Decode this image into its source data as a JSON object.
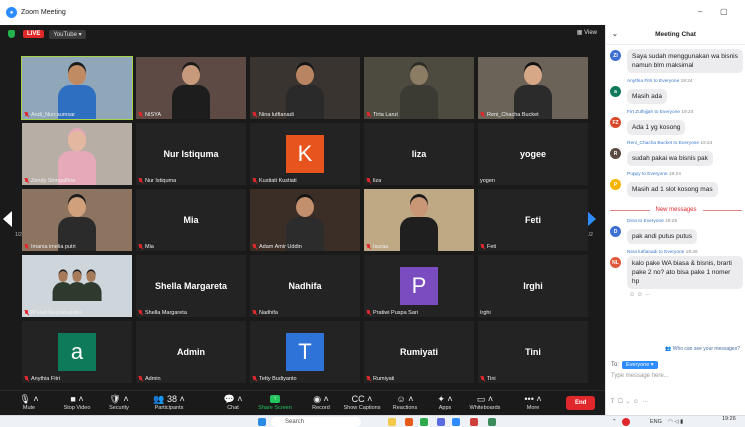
{
  "window": {
    "title": "Zoom Meeting",
    "minimize": "–",
    "restore": "▢"
  },
  "topbar": {
    "live": "LIVE",
    "stream": "YouTube ▾",
    "view": "View"
  },
  "gallery": {
    "page_left": "1/2",
    "page_right": "1/2",
    "tiles": [
      {
        "name": "Andi_Nurcaumsar",
        "video": true,
        "speaking": true,
        "bg": "#8fa7b8",
        "skin": "#c08a62",
        "shirt": "#2f6fc2",
        "hair": "#1b1b1b"
      },
      {
        "name": "NISYA",
        "video": true,
        "bg": "#5d4a44",
        "skin": "#c79a7c",
        "shirt": "#1d1d1d",
        "hair": "#1a1a1a"
      },
      {
        "name": "Nina lutfianadi",
        "video": true,
        "bg": "#3a3430",
        "skin": "#b98462",
        "shirt": "#2a2a2a",
        "hair": "#151515"
      },
      {
        "name": "Tirta Larut",
        "video": true,
        "bg": "#4d4a3f",
        "skin": "#8a7d63",
        "shirt": "#3b3a33",
        "hair": "#2e2c26"
      },
      {
        "name": "Reni_Chacha Bucket",
        "video": true,
        "bg": "#6b6357",
        "skin": "#d6a888",
        "shirt": "#2b2b2b",
        "hair": "#111111"
      },
      {
        "name": "Zendy Sinngalfina",
        "video": true,
        "bg": "#b7aea6",
        "skin": "#e4b8a0",
        "shirt": "#e6a9b9",
        "hair": "#e6a9b9"
      },
      {
        "name": "Nur Istiquma",
        "bigname": "Nur Istiquma"
      },
      {
        "name": "Kustiati Kustiati",
        "avatar": "K",
        "avatar_color": "#e8541d"
      },
      {
        "name": "liza",
        "bigname": "liza"
      },
      {
        "name": "yogen",
        "bigname": "yogee",
        "no_icon": true
      },
      {
        "name": "Imania imelia putri",
        "video": true,
        "bg": "#8c7460",
        "skin": "#d0a07c",
        "shirt": "#2b2b2b",
        "hair": "#1c1c1c"
      },
      {
        "name": "Mia",
        "bigname": "Mia"
      },
      {
        "name": "Adam Amir Uddin",
        "video": true,
        "bg": "#3a2e27",
        "skin": "#c28f6d",
        "shirt": "#2c2c2c",
        "hair": "#141414"
      },
      {
        "name": "Isuraa",
        "video": true,
        "bg": "#bfa884",
        "skin": "#c99676",
        "shirt": "#1f1f1f",
        "hair": "#1a1a1a"
      },
      {
        "name": "Feti",
        "bigname": "Feti"
      },
      {
        "name": "M Hafi Nugrahaputra",
        "video": true,
        "bg": "#cfd6db",
        "skin": "#a77b5a",
        "shirt": "#2f3a2f",
        "hair": "#1a1a1a",
        "group": true
      },
      {
        "name": "Shella Margareta",
        "bigname": "Shella Margareta"
      },
      {
        "name": "Nadhifa",
        "bigname": "Nadhifa"
      },
      {
        "name": "Pratiwi Puspa Sari",
        "avatar": "P",
        "avatar_color": "#7a4cc0"
      },
      {
        "name": "Irghi",
        "bigname": "Irghi",
        "no_icon": true
      },
      {
        "name": "Anythia Fitri",
        "avatar": "a",
        "avatar_color": "#0f7a5a"
      },
      {
        "name": "Admin",
        "bigname": "Admin"
      },
      {
        "name": "Tetty Budiyanto",
        "avatar": "T",
        "avatar_color": "#2d73d8"
      },
      {
        "name": "Rumiyati",
        "bigname": "Rumiyati"
      },
      {
        "name": "Tini",
        "bigname": "Tini"
      }
    ]
  },
  "toolbar": {
    "items": [
      {
        "label": "Mute",
        "icon": "🎙"
      },
      {
        "label": "Stop Video",
        "icon": "■"
      },
      {
        "label": "Security",
        "icon": "🛡"
      },
      {
        "label": "Participants",
        "icon": "👥",
        "count": "38"
      },
      {
        "label": "Chat",
        "icon": "💬"
      },
      {
        "label": "Share Screen",
        "icon": "↑",
        "green": true
      },
      {
        "label": "Record",
        "icon": "◉"
      },
      {
        "label": "Show Captions",
        "icon": "CC"
      },
      {
        "label": "Reactions",
        "icon": "☺"
      },
      {
        "label": "Apps",
        "icon": "✦"
      },
      {
        "label": "Whiteboards",
        "icon": "▭"
      },
      {
        "label": "More",
        "icon": "•••"
      }
    ],
    "end": "End"
  },
  "chat": {
    "title": "Meeting Chat",
    "messages": [
      {
        "avatar": "ZI",
        "avatar_color": "#3f6fd1",
        "text": "Saya sudah menggunakan wa bisnis namun blm maksimal"
      },
      {
        "sender": "Anythia Fitri",
        "to": "to Everyone",
        "time": "19:24",
        "avatar": "a",
        "avatar_color": "#0f7a5a",
        "text": "Masih ada"
      },
      {
        "sender": "Firt Zulhijjah",
        "to": "to Everyone",
        "time": "19:24",
        "avatar": "FZ",
        "avatar_color": "#d9472b",
        "text": "Ada 1 yg kosong"
      },
      {
        "sender": "Reni_Chacha Bucket",
        "to": "to Everyone",
        "time": "19:24",
        "avatar": "R",
        "avatar_color": "#5a4a42",
        "text": "sudah pakai wa bisnis pak"
      },
      {
        "sender": "Poppy",
        "to": "to Everyone",
        "time": "19:24",
        "avatar": "P",
        "avatar_color": "#f4b400",
        "text": "Masih ad 1 slot kosong mas"
      }
    ],
    "new_messages": "New messages",
    "new": [
      {
        "sender": "Dina",
        "to": "to Everyone",
        "time": "19:25",
        "avatar": "D",
        "avatar_color": "#3f6fd1",
        "text": "pak andi putus putus"
      },
      {
        "sender": "Nina lutfianadi",
        "to": "to Everyone",
        "time": "19:26",
        "avatar": "NL",
        "avatar_color": "#e0583a",
        "text": "kalo pake WA biasa & bisnis, brarti pake 2 no? ato bisa pake 1 nomer hp"
      }
    ],
    "who_can_see": "Who can see your messages?",
    "to_label": "To:",
    "to_value": "Everyone ▾",
    "placeholder": "Type message here..."
  },
  "taskbar": {
    "search": "Search",
    "lang": "ENG",
    "time": "19:26"
  }
}
